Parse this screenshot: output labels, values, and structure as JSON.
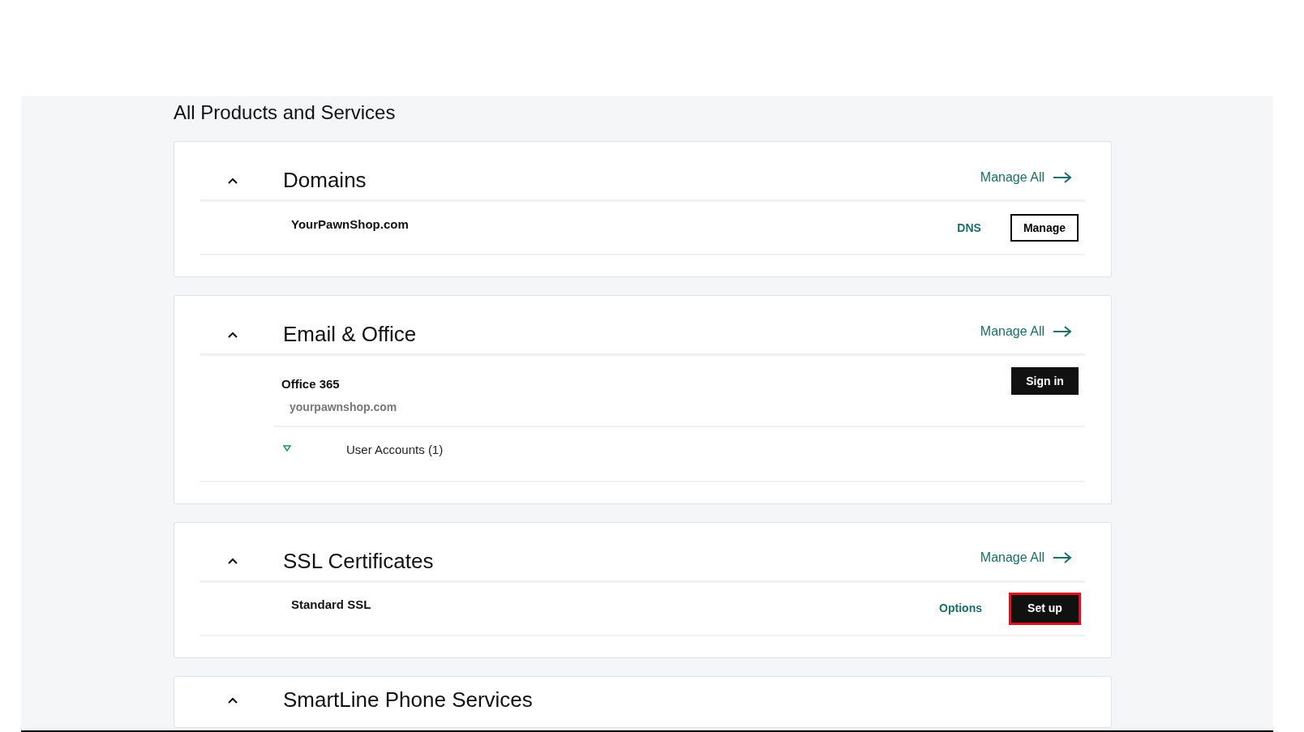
{
  "page_title": "All Products and Services",
  "sections": [
    {
      "title": "Domains",
      "expanded": true,
      "manage_all": "Manage All",
      "items": [
        {
          "name": "YourPawnShop.com",
          "actions": [
            {
              "kind": "link",
              "label": "DNS",
              "highlighted": false
            },
            {
              "kind": "outline",
              "label": "Manage",
              "highlighted": false
            }
          ]
        }
      ]
    },
    {
      "title": "Email & Office",
      "expanded": true,
      "manage_all": "Manage All",
      "items": [
        {
          "name": "Office 365",
          "subtitle": "yourpawnshop.com",
          "actions": [
            {
              "kind": "solid",
              "label": "Sign in",
              "highlighted": false
            }
          ],
          "sub_rows": [
            {
              "label": "User Accounts (1)"
            }
          ]
        }
      ]
    },
    {
      "title": "SSL Certificates",
      "expanded": true,
      "manage_all": "Manage All",
      "items": [
        {
          "name": "Standard SSL",
          "actions": [
            {
              "kind": "link",
              "label": "Options",
              "highlighted": false
            },
            {
              "kind": "solid",
              "label": "Set up",
              "highlighted": true
            }
          ]
        }
      ]
    },
    {
      "title": "SmartLine Phone Services",
      "expanded": true
    }
  ]
}
